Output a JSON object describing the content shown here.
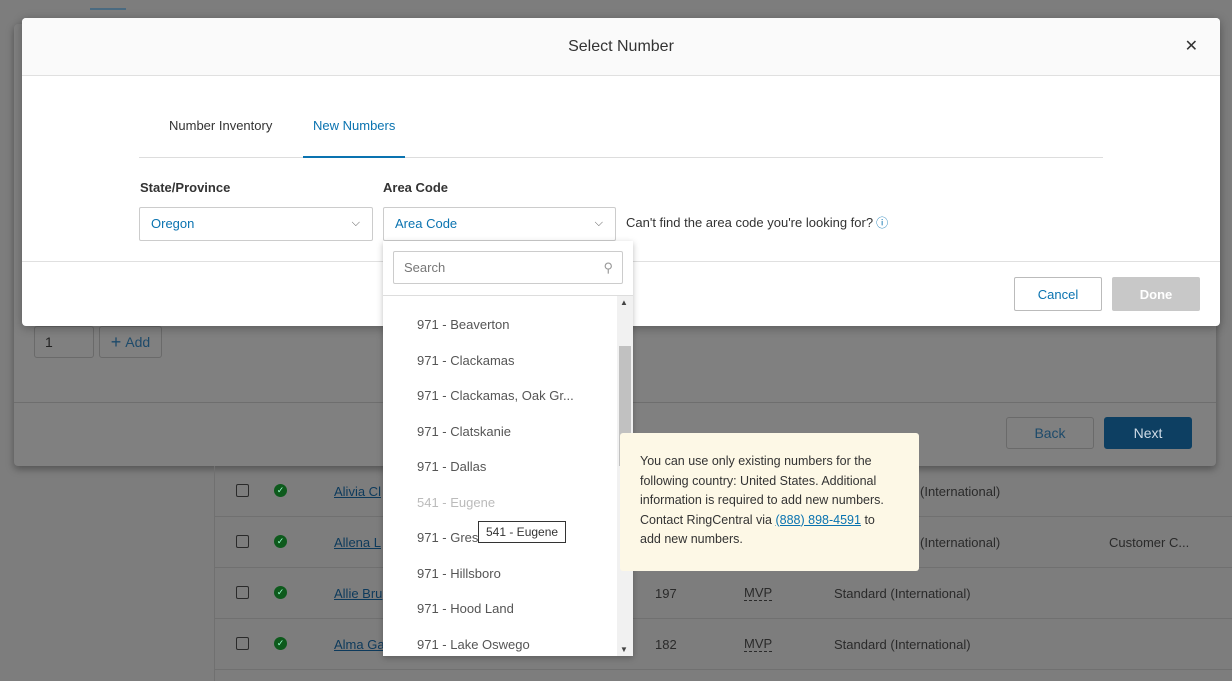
{
  "dialog": {
    "title": "Select Number",
    "close_icon": "close-icon",
    "tabs": [
      {
        "label": "Number Inventory",
        "active": false
      },
      {
        "label": "New Numbers",
        "active": true
      }
    ],
    "state_label": "State/Province",
    "state_value": "Oregon",
    "area_label": "Area Code",
    "area_value": "Area Code",
    "hint": "Can't find the area code you're looking for?",
    "hint_icon": "info-icon",
    "cancel": "Cancel",
    "done": "Done"
  },
  "dropdown": {
    "search_placeholder": "Search",
    "items": [
      {
        "label": "971 - Beaverton"
      },
      {
        "label": "971 - Clackamas"
      },
      {
        "label": "971 - Clackamas, Oak Gr..."
      },
      {
        "label": "971 - Clatskanie"
      },
      {
        "label": "971 - Dallas"
      },
      {
        "label": "541 - Eugene",
        "disabled": true
      },
      {
        "label": "971 - Gresham"
      },
      {
        "label": "971 - Hillsboro"
      },
      {
        "label": "971 - Hood Land"
      },
      {
        "label": "971 - Lake Oswego"
      }
    ],
    "tooltip": "541 - Eugene"
  },
  "note": {
    "text1": "You can use only existing numbers for the following country: United States. Additional information is required to add new numbers. Contact RingCentral via ",
    "phone": "(888) 898-4591",
    "text2": " to add new numbers."
  },
  "background": {
    "quantity": "1",
    "add": "Add",
    "back": "Back",
    "next": "Next",
    "rows": [
      {
        "name": "Alivia Cl",
        "ext": "",
        "role": "",
        "type": "(International)",
        "extra": ""
      },
      {
        "name": "Allena L",
        "ext": "",
        "role": "",
        "type": "(International)",
        "extra": "Customer C..."
      },
      {
        "name": "Allie Bru",
        "ext": "197",
        "role": "MVP",
        "type": "Standard (International)",
        "extra": ""
      },
      {
        "name": "Alma Ga",
        "ext": "182",
        "role": "MVP",
        "type": "Standard (International)",
        "extra": ""
      }
    ]
  },
  "colors": {
    "accent": "#0a73b0",
    "next": "#0d4a75",
    "note_bg": "#fdf8e6"
  }
}
